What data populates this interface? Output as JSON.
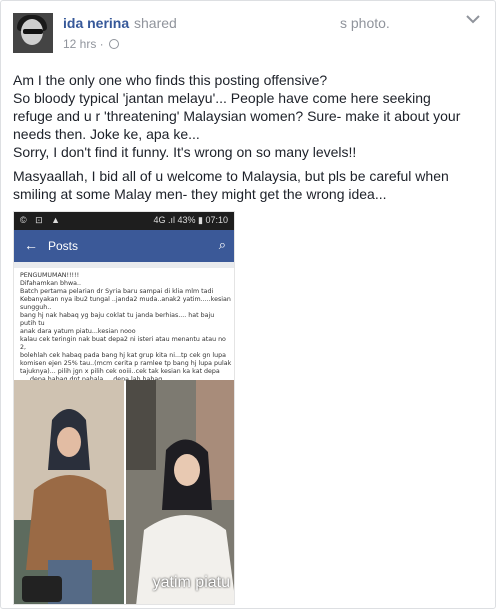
{
  "post": {
    "author": "ida nerina",
    "shared": "shared",
    "photo": "s photo.",
    "time": "12 hrs ·",
    "paragraph1_lines": [
      "Am I the only one who finds this posting offensive?",
      "So bloody typical 'jantan melayu'... People have come here seeking",
      "refuge and u r 'threatening' Malaysian women? Sure- make it about your",
      "needs then. Joke ke, apa ke...",
      "Sorry, I don't find it funny. It's wrong on so many levels!!"
    ],
    "paragraph2_lines": [
      "Masyaallah, I bid all of u welcome to Malaysia, but pls be careful when",
      "smiling at some Malay men- they might get the wrong idea..."
    ]
  },
  "screenshot": {
    "status_left": "© ⊡ ▲",
    "status_right": "4G .ıl 43% ▮ 07:10",
    "appbar_back": "←",
    "appbar_title": "Posts",
    "appbar_search": "⌕",
    "notice_lines": [
      "PENGUMUMAN!!!!!",
      "Difahamkan bhwa..",
      "Batch pertama pelarian dr Syria baru sampai di klia mlm tadi",
      "Kebanyakan nya ibu2 tungal ..janda2 muda..anak2 yatim.....kesian",
      "sungguh..",
      "bang hj nak habaq yg baju coklat tu janda berhias.... hat baju putih tu",
      "anak dara yatum piatu...kesian nooo",
      "kalau cek teringin nak buat depa2 ni isteri atau menantu atau no 2,",
      "bolehlah cek habaq pada bang hj kat grup kita ni...tp cek gn lupa",
      "komisen ejen 25% tau..(mcm cerita p ramlee tp bang hj lupa pulak",
      "tajuknya)... pilih jgn x pilih cek ooiii..cek tak kesian ka kat depa",
      ".....depa habaq dpt pahala.....depa lah habaq..."
    ],
    "caption": "yatim piatu"
  },
  "colors": {
    "author": "#365899",
    "meta": "#90949c",
    "appbar": "#3b5998"
  }
}
